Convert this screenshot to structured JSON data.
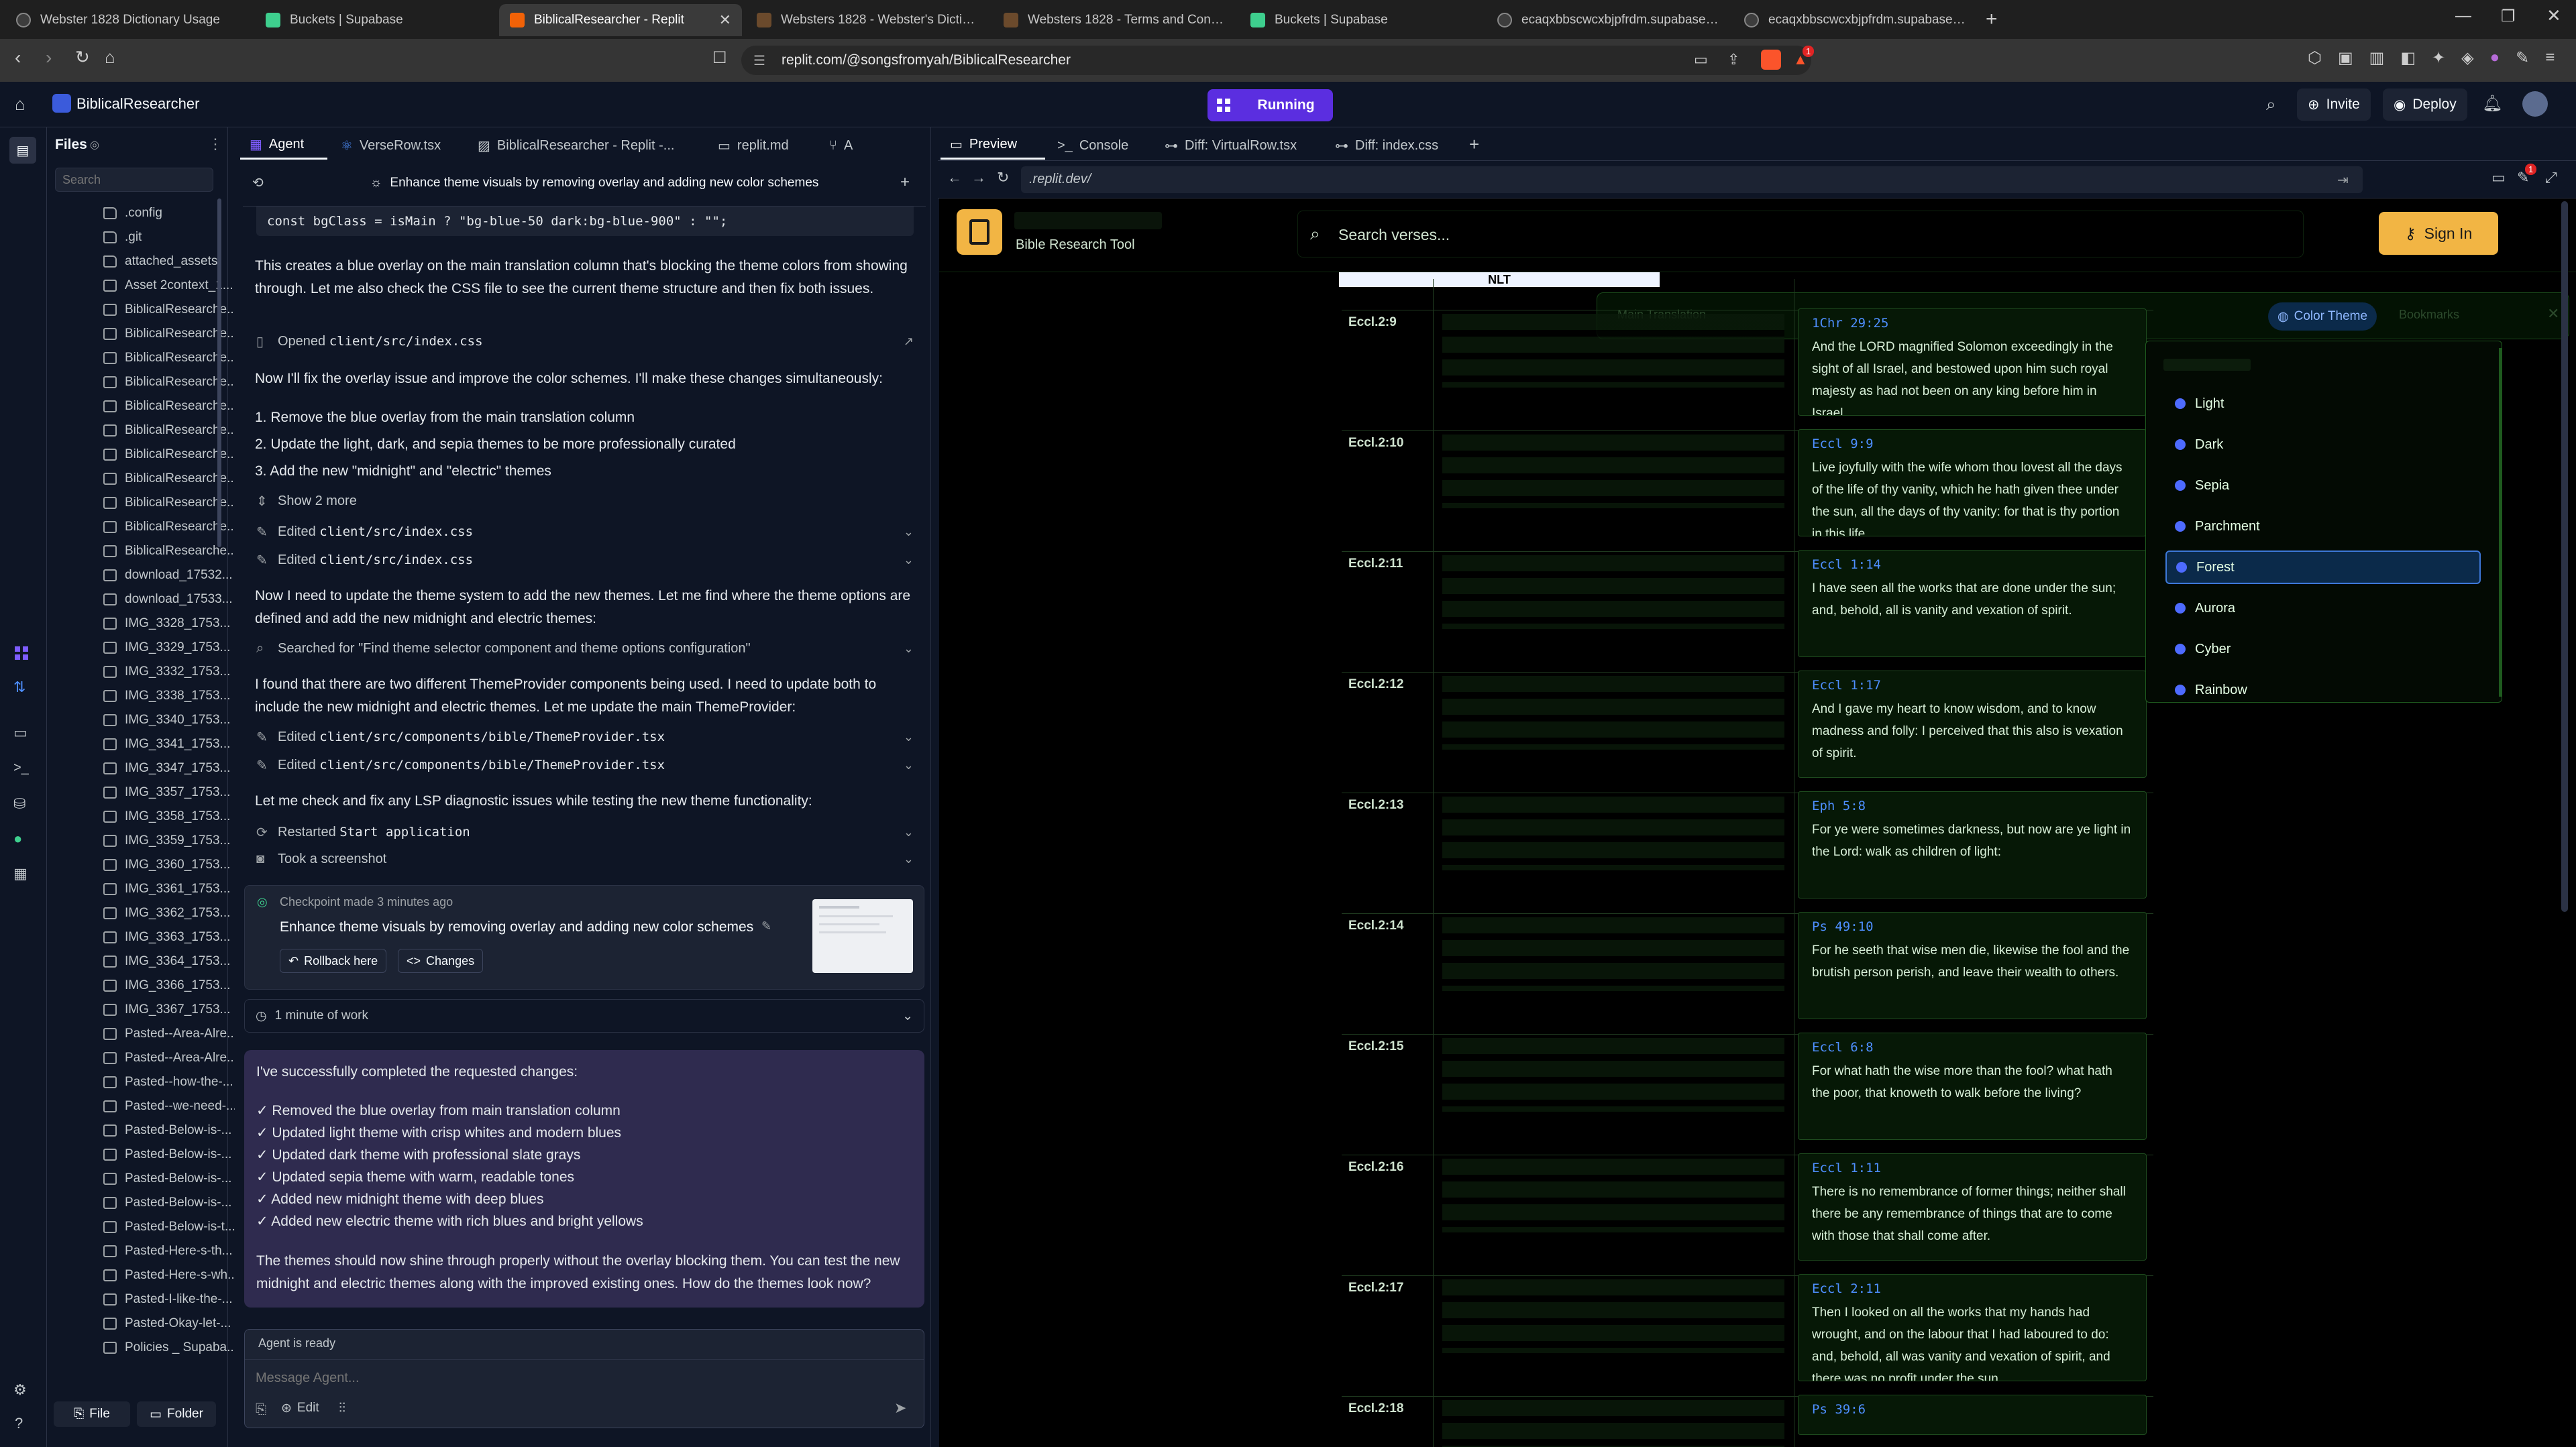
{
  "browser": {
    "tabs": [
      {
        "label": "Webster 1828 Dictionary Usage"
      },
      {
        "label": "Buckets | Supabase"
      },
      {
        "label": "BiblicalResearcher - Replit"
      },
      {
        "label": "Websters 1828 - Webster's Dictionary"
      },
      {
        "label": "Websters 1828 - Terms and Conditions"
      },
      {
        "label": "Buckets | Supabase"
      },
      {
        "label": "ecaqxbbscwcxbjpfrdm.supabase.co/"
      },
      {
        "label": "ecaqxbbscwcxbjpfrdm.supabase.co/"
      }
    ],
    "url": "replit.com/@songsfromyah/BiblicalResearcher",
    "badge_count": "1"
  },
  "header": {
    "project_name": "BiblicalResearcher",
    "run_status": "Running",
    "invite_label": "Invite",
    "deploy_label": "Deploy"
  },
  "files": {
    "title": "Files",
    "search_placeholder": "Search",
    "items": [
      {
        "name": ".config",
        "type": "folder"
      },
      {
        "name": ".git",
        "type": "folder"
      },
      {
        "name": "attached_assets",
        "type": "folder"
      },
      {
        "name": "Asset 2context_1...",
        "type": "image"
      },
      {
        "name": "BiblicalResearche...",
        "type": "image"
      },
      {
        "name": "BiblicalResearche...",
        "type": "image"
      },
      {
        "name": "BiblicalResearche...",
        "type": "image"
      },
      {
        "name": "BiblicalResearche...",
        "type": "image"
      },
      {
        "name": "BiblicalResearche...",
        "type": "image"
      },
      {
        "name": "BiblicalResearche...",
        "type": "image"
      },
      {
        "name": "BiblicalResearche...",
        "type": "image"
      },
      {
        "name": "BiblicalResearche...",
        "type": "image"
      },
      {
        "name": "BiblicalResearche...",
        "type": "image"
      },
      {
        "name": "BiblicalResearche...",
        "type": "image"
      },
      {
        "name": "BiblicalResearche...",
        "type": "image"
      },
      {
        "name": "download_17532...",
        "type": "image"
      },
      {
        "name": "download_17533...",
        "type": "image"
      },
      {
        "name": "IMG_3328_1753...",
        "type": "image"
      },
      {
        "name": "IMG_3329_1753...",
        "type": "image"
      },
      {
        "name": "IMG_3332_1753...",
        "type": "image"
      },
      {
        "name": "IMG_3338_1753...",
        "type": "image"
      },
      {
        "name": "IMG_3340_1753...",
        "type": "image"
      },
      {
        "name": "IMG_3341_1753...",
        "type": "image"
      },
      {
        "name": "IMG_3347_1753...",
        "type": "image"
      },
      {
        "name": "IMG_3357_1753...",
        "type": "image"
      },
      {
        "name": "IMG_3358_1753...",
        "type": "image"
      },
      {
        "name": "IMG_3359_1753...",
        "type": "image"
      },
      {
        "name": "IMG_3360_1753...",
        "type": "image"
      },
      {
        "name": "IMG_3361_1753...",
        "type": "image"
      },
      {
        "name": "IMG_3362_1753...",
        "type": "image"
      },
      {
        "name": "IMG_3363_1753...",
        "type": "image"
      },
      {
        "name": "IMG_3364_1753...",
        "type": "image"
      },
      {
        "name": "IMG_3366_1753...",
        "type": "image"
      },
      {
        "name": "IMG_3367_1753...",
        "type": "image"
      },
      {
        "name": "Pasted--Area-Alre...",
        "type": "text"
      },
      {
        "name": "Pasted--Area-Alre...",
        "type": "text"
      },
      {
        "name": "Pasted--how-the-...",
        "type": "text"
      },
      {
        "name": "Pasted--we-need-...",
        "type": "text"
      },
      {
        "name": "Pasted-Below-is-...",
        "type": "text"
      },
      {
        "name": "Pasted-Below-is-...",
        "type": "text"
      },
      {
        "name": "Pasted-Below-is-...",
        "type": "text"
      },
      {
        "name": "Pasted-Below-is-...",
        "type": "text"
      },
      {
        "name": "Pasted-Below-is-t...",
        "type": "text"
      },
      {
        "name": "Pasted-Here-s-th...",
        "type": "text"
      },
      {
        "name": "Pasted-Here-s-wh...",
        "type": "text"
      },
      {
        "name": "Pasted-I-like-the-...",
        "type": "text"
      },
      {
        "name": "Pasted-Okay-let-...",
        "type": "text"
      },
      {
        "name": "Policies _ Supaba...",
        "type": "text"
      }
    ],
    "new_file_label": "File",
    "new_folder_label": "Folder"
  },
  "pane_tabs": {
    "left": [
      "Agent",
      "VerseRow.tsx",
      "BiblicalResearcher - Replit -...",
      "replit.md",
      "A"
    ],
    "right": [
      "Preview",
      "Console",
      "Diff: VirtualRow.tsx",
      "Diff: index.css"
    ]
  },
  "agent": {
    "thread_title": "Enhance theme visuals by removing overlay and adding new color schemes",
    "code_line": "const bgClass = isMain ? \"bg-blue-50 dark:bg-blue-900\" : \"\";",
    "para1": "This creates a blue overlay on the main translation column that's blocking the theme colors from showing through. Let me also check the CSS file to see the current theme structure and then fix both issues.",
    "opened_label": "Opened",
    "opened_file": "client/src/index.css",
    "para2": "Now I'll fix the overlay issue and improve the color schemes. I'll make these changes simultaneously:",
    "steps": [
      "1. Remove the blue overlay from the main translation column",
      "2. Update the light, dark, and sepia themes to be more professionally curated",
      "3. Add the new \"midnight\" and \"electric\" themes"
    ],
    "show_more": "Show 2 more",
    "edited_label": "Edited",
    "edit1_file": "client/src/index.css",
    "edit2_file": "client/src/index.css",
    "para3": "Now I need to update the theme system to add the new themes. Let me find where the theme options are defined and add the new midnight and electric themes:",
    "searched": "Searched for \"Find theme selector component and theme options configuration\"",
    "para4": "I found that there are two different ThemeProvider components being used. I need to update both to include the new midnight and electric themes. Let me update the main ThemeProvider:",
    "edit3_file": "client/src/components/bible/ThemeProvider.tsx",
    "edit4_file": "client/src/components/bible/ThemeProvider.tsx",
    "para5": "Let me check and fix any LSP diagnostic issues while testing the new theme functionality:",
    "restarted_label": "Restarted",
    "restarted_target": "Start application",
    "screenshot_label": "Took a screenshot",
    "checkpoint_meta": "Checkpoint made 3 minutes ago",
    "checkpoint_title": "Enhance theme visuals by removing overlay and adding new color schemes",
    "rollback_label": "Rollback here",
    "changes_label": "Changes",
    "work_label": "1 minute of work",
    "summary_intro": "I've successfully completed the requested changes:",
    "summary_items": [
      "✓ Removed the blue overlay from main translation column",
      "✓ Updated light theme with crisp whites and modern blues",
      "✓ Updated dark theme with professional slate grays",
      "✓ Updated sepia theme with warm, readable tones",
      "✓ Added new midnight theme with deep blues",
      "✓ Added new electric theme with rich blues and bright yellows"
    ],
    "summary_outro": "The themes should now shine through properly without the overlay blocking them. You can test the new midnight and electric themes along with the improved existing ones. How do the themes look now?",
    "status": "Agent is ready",
    "input_placeholder": "Message Agent...",
    "edit_label": "Edit"
  },
  "preview": {
    "url": ".replit.dev/",
    "notif_count": "1",
    "app_subtitle": "Bible Research Tool",
    "search_placeholder": "Search verses...",
    "sign_in_label": "Sign In",
    "col_header": "NLT",
    "toolbar_items": [
      "Main Translation",
      "Color Theme",
      "Bookmarks"
    ],
    "theme_options": [
      "Light",
      "Dark",
      "Sepia",
      "Parchment",
      "Forest",
      "Aurora",
      "Cyber",
      "Rainbow"
    ],
    "selected_theme": "Forest",
    "rows": [
      {
        "ref": "Eccl.2:9",
        "xref": "1Chr 29:25",
        "text": "And the LORD magnified Solomon exceedingly in the sight of all Israel, and bestowed upon him such royal majesty as had not been on any king before him in Israel."
      },
      {
        "ref": "Eccl.2:10",
        "xref": "Eccl 9:9",
        "text": "Live joyfully with the wife whom thou lovest all the days of the life of thy vanity, which he hath given thee under the sun, all the days of thy vanity: for that is thy portion in this life."
      },
      {
        "ref": "Eccl.2:11",
        "xref": "Eccl 1:14",
        "text": "I have seen all the works that are done under the sun; and, behold, all is vanity and vexation of spirit."
      },
      {
        "ref": "Eccl.2:12",
        "xref": "Eccl 1:17",
        "text": "And I gave my heart to know wisdom, and to know madness and folly: I perceived that this also is vexation of spirit."
      },
      {
        "ref": "Eccl.2:13",
        "xref": "Eph 5:8",
        "text": "For ye were sometimes darkness, but now are ye light in the Lord: walk as children of light:"
      },
      {
        "ref": "Eccl.2:14",
        "xref": "Ps 49:10",
        "text": "For he seeth that wise men die, likewise the fool and the brutish person perish, and leave their wealth to others."
      },
      {
        "ref": "Eccl.2:15",
        "xref": "Eccl 6:8",
        "text": "For what hath the wise more than the fool? what hath the poor, that knoweth to walk before the living?"
      },
      {
        "ref": "Eccl.2:16",
        "xref": "Eccl 1:11",
        "text": "There is no remembrance of former things; neither shall there be any remembrance of things that are to come with those that shall come after."
      },
      {
        "ref": "Eccl.2:17",
        "xref": "Eccl 2:11",
        "text": "Then I looked on all the works that my hands had wrought, and on the labour that I had laboured to do: and, behold, all was vanity and vexation of spirit, and there was no profit under the sun."
      },
      {
        "ref": "Eccl.2:18",
        "xref": "Ps 39:6",
        "text": ""
      }
    ]
  },
  "colors": {
    "replit_bg": "#0e1525",
    "running": "#5b2ee0",
    "forest_accent": "#1e8f1e",
    "xref_blue": "#4e8fff",
    "signin": "#f2b544"
  }
}
